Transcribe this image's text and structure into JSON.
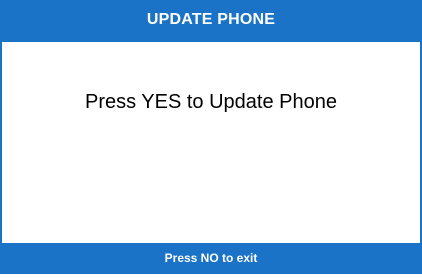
{
  "header": {
    "title": "UPDATE PHONE"
  },
  "main": {
    "message": "Press YES to Update Phone"
  },
  "footer": {
    "hint": "Press NO to exit"
  },
  "colors": {
    "accent": "#1a73c7",
    "background": "#ffffff",
    "text": "#000000",
    "bar_text": "#ffffff"
  }
}
